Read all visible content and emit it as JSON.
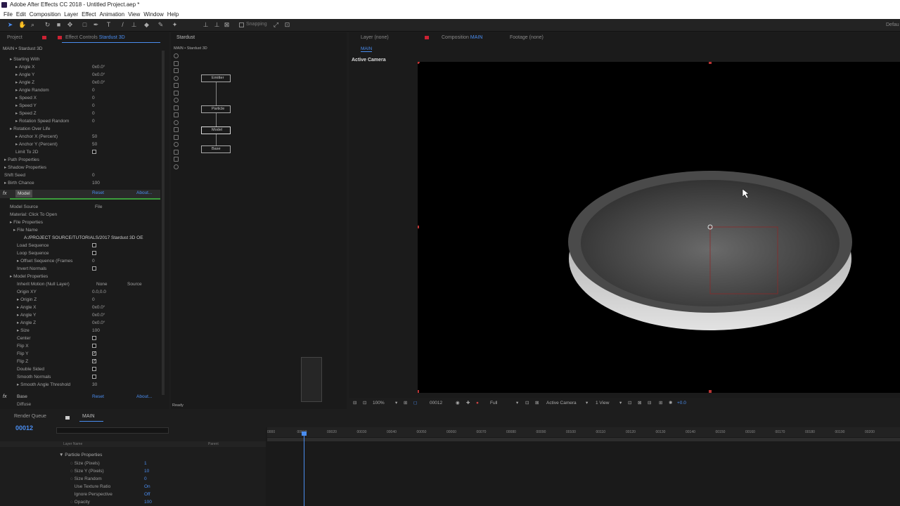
{
  "window_title": "Adobe After Effects CC 2018 - Untitled Project.aep *",
  "menu": [
    "File",
    "Edit",
    "Composition",
    "Layer",
    "Effect",
    "Animation",
    "View",
    "Window",
    "Help"
  ],
  "toolbar": {
    "snapping": "Snapping",
    "workspace": "Defau"
  },
  "left_panel": {
    "tab_project": "Project",
    "tab_effect": "Effect Controls",
    "tab_effect_target": "Stardust 3D",
    "breadcrumb": "MAIN • Stardust 3D",
    "rows": [
      {
        "label": "Starting With",
        "indent": 1,
        "tri": true,
        "val": ""
      },
      {
        "label": "Angle X",
        "indent": 2,
        "tri": true,
        "val": "0x0.0°"
      },
      {
        "label": "Angle Y",
        "indent": 2,
        "tri": true,
        "val": "0x0.0°"
      },
      {
        "label": "Angle Z",
        "indent": 2,
        "tri": true,
        "val": "0x0.0°"
      },
      {
        "label": "Angle Random",
        "indent": 2,
        "tri": true,
        "val": "0"
      },
      {
        "label": "Speed X",
        "indent": 2,
        "tri": true,
        "val": "0"
      },
      {
        "label": "Speed Y",
        "indent": 2,
        "tri": true,
        "val": "0"
      },
      {
        "label": "Speed Z",
        "indent": 2,
        "tri": true,
        "val": "0"
      },
      {
        "label": "Rotation Speed Random",
        "indent": 2,
        "tri": true,
        "val": "0"
      },
      {
        "label": "Rotation Over Life",
        "indent": 1,
        "tri": true,
        "val": ""
      },
      {
        "label": "Anchor X (Percent)",
        "indent": 2,
        "tri": true,
        "val": "50"
      },
      {
        "label": "Anchor Y (Percent)",
        "indent": 2,
        "tri": true,
        "val": "50"
      },
      {
        "label": "Limit To 2D",
        "indent": 2,
        "tri": false,
        "val": "",
        "check": false
      },
      {
        "label": "Path Properties",
        "indent": 0,
        "tri": true,
        "val": ""
      },
      {
        "label": "Shadow Properties",
        "indent": 0,
        "tri": true,
        "val": ""
      },
      {
        "label": "Shift Seed",
        "indent": 0,
        "tri": false,
        "val": "0"
      },
      {
        "label": "Birth Chance",
        "indent": 0,
        "tri": true,
        "val": "100"
      }
    ],
    "model_label": "Model",
    "reset": "Reset",
    "about": "About...",
    "model_rows": [
      {
        "label": "Model Source",
        "val": "File"
      },
      {
        "label": "Material: Click To Open",
        "val": ""
      },
      {
        "label": "File Properties",
        "val": ""
      },
      {
        "label": "File Name",
        "val": ""
      },
      {
        "label": "A:/PROJECT SOURCE/TUTORIALS/2017 Stardust 3D OE",
        "val": ""
      },
      {
        "label": "Load Sequence",
        "val": "",
        "check": false
      },
      {
        "label": "Loop Sequence",
        "val": "",
        "check": false
      },
      {
        "label": "Offset Sequence (Frames",
        "val": "0"
      },
      {
        "label": "Invert Normals",
        "val": "",
        "check": false
      },
      {
        "label": "Model Properties",
        "val": ""
      },
      {
        "label": "Inherit Motion (Null Layer)",
        "val": "None"
      },
      {
        "label": "Origin XY",
        "val": "0.0,0.0"
      },
      {
        "label": "Origin Z",
        "val": "0"
      },
      {
        "label": "Angle X",
        "val": "0x0.0°"
      },
      {
        "label": "Angle Y",
        "val": "0x0.0°"
      },
      {
        "label": "Angle Z",
        "val": "0x0.0°"
      },
      {
        "label": "Size",
        "val": "100"
      },
      {
        "label": "Center",
        "val": "",
        "check": false
      },
      {
        "label": "Flip X",
        "val": "",
        "check": false
      },
      {
        "label": "Flip Y",
        "val": "",
        "check": true
      },
      {
        "label": "Flip Z",
        "val": "",
        "check": true
      },
      {
        "label": "Double Sided",
        "val": "",
        "check": false
      },
      {
        "label": "Smooth Normals",
        "val": "",
        "check": false
      },
      {
        "label": "Smooth Angle Threshold",
        "val": "30"
      }
    ],
    "inherit_source": "Source",
    "base_label": "Base",
    "diffuse_label": "Diffuse"
  },
  "stardust_panel": {
    "tab": "Stardust",
    "breadcrumb": "MAIN • Stardust 3D",
    "nodes": [
      "Emitter",
      "Particle",
      "Model",
      "Base"
    ],
    "status": "Ready"
  },
  "viewer": {
    "tab_layer": "Layer (none)",
    "tab_comp": "Composition",
    "tab_comp_name": "MAIN",
    "tab_footage": "Footage (none)",
    "sub_tab": "MAIN",
    "active_camera_label": "Active Camera",
    "zoom": "100%",
    "timecode": "00012",
    "resolution": "Full",
    "camera": "Active Camera",
    "views": "1 View",
    "exposure": "+0.0"
  },
  "timeline": {
    "tab_render": "Render Queue",
    "tab_main": "MAIN",
    "current_time": "00012",
    "layer_name_header": "Layer Name",
    "parent_header": "Parent",
    "group_label": "Particle Properties",
    "props": [
      {
        "label": "Size (Pixels)",
        "val": "1"
      },
      {
        "label": "Size Y (Pixels)",
        "val": "10"
      },
      {
        "label": "Size Random",
        "val": "0"
      },
      {
        "label": "Use Texture Ratio",
        "val": "On"
      },
      {
        "label": "Ignore Perspective",
        "val": "Off"
      },
      {
        "label": "Opacity",
        "val": "100"
      }
    ],
    "ruler": [
      "0000",
      "00010",
      "00020",
      "00030",
      "00040",
      "00050",
      "00060",
      "00070",
      "00080",
      "00090",
      "00100",
      "00110",
      "00120",
      "00130",
      "00140",
      "00150",
      "00160",
      "00170",
      "00180",
      "00190",
      "00200"
    ]
  }
}
